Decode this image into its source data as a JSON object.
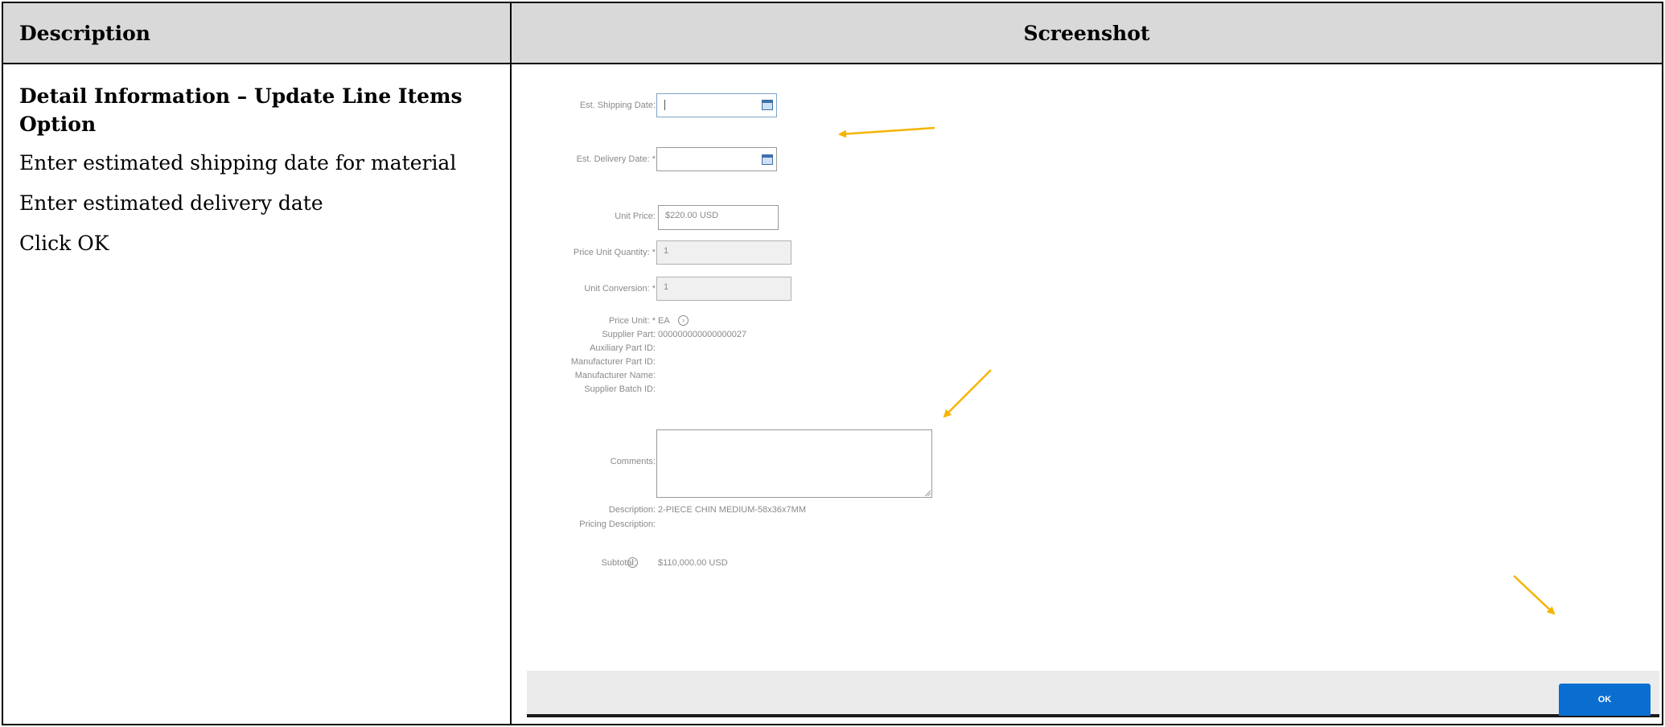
{
  "table": {
    "headers": {
      "description": "Description",
      "screenshot": "Screenshot"
    },
    "description": {
      "title": "Detail Information – Update Line Items Option",
      "steps": [
        "Enter estimated shipping date for material",
        "Enter estimated delivery date",
        "Click OK"
      ]
    }
  },
  "form": {
    "fields": {
      "shipping_date": {
        "label": "Est. Shipping Date:",
        "value": ""
      },
      "delivery_date": {
        "label": "Est. Delivery Date: *",
        "value": ""
      },
      "unit_price": {
        "label": "Unit Price:",
        "value": "$220.00 USD"
      },
      "price_unit_quantity": {
        "label": "Price Unit Quantity: *",
        "value": "1"
      },
      "unit_conversion": {
        "label": "Unit Conversion: *",
        "value": "1"
      },
      "price_unit": {
        "label": "Price Unit: *",
        "value": "EA"
      },
      "supplier_part": {
        "label": "Supplier Part:",
        "value": "000000000000000027"
      },
      "auxiliary_part_id": {
        "label": "Auxiliary Part ID:"
      },
      "manufacturer_part_id": {
        "label": "Manufacturer Part ID:"
      },
      "manufacturer_name": {
        "label": "Manufacturer Name:"
      },
      "supplier_batch_id": {
        "label": "Supplier Batch ID:"
      },
      "comments": {
        "label": "Comments:",
        "value": ""
      },
      "description": {
        "label": "Description:",
        "value": "2-PIECE CHIN MEDIUM-58x36x7MM"
      },
      "pricing_description": {
        "label": "Pricing Description:"
      },
      "subtotal": {
        "label": "Subtotal:",
        "value": "$110,000.00 USD"
      }
    },
    "ok_label": "OK"
  },
  "colors": {
    "accent": "#0a6ed1",
    "annotation_arrow": "#f5b400",
    "header_bg": "#d9d9d9"
  },
  "icons": [
    "calendar-icon",
    "info-icon",
    "annotation-arrow"
  ]
}
